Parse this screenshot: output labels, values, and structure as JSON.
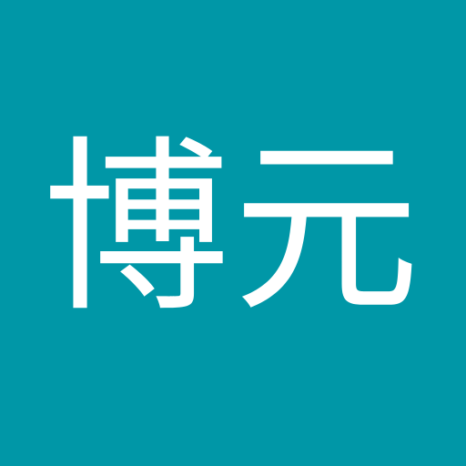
{
  "avatar": {
    "initials": "博元",
    "background_color": "#0097a7",
    "text_color": "#ffffff"
  }
}
